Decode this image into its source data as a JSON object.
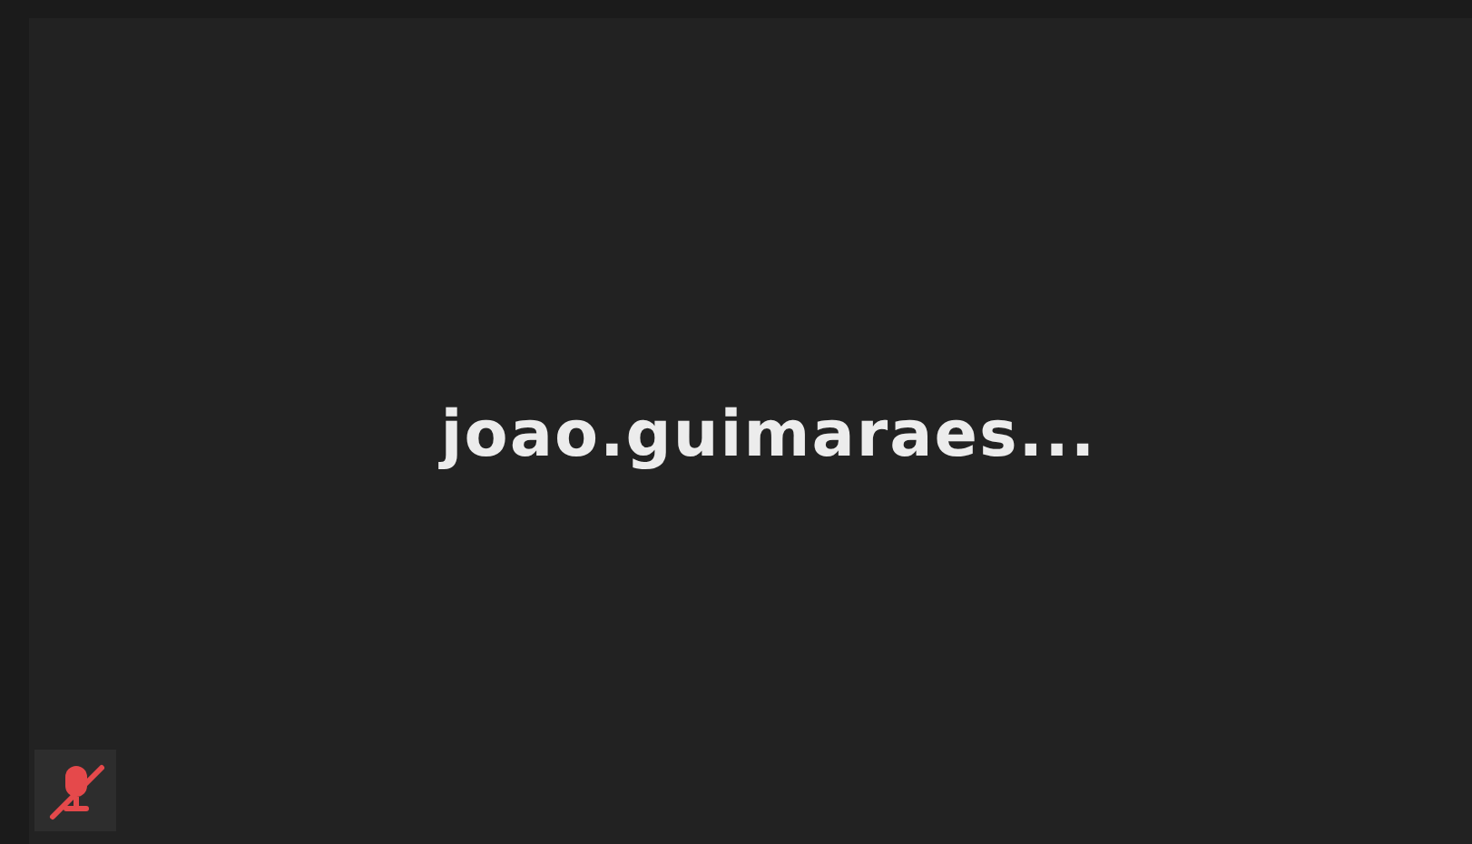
{
  "participant": {
    "name": "joao.guimaraes...",
    "muted": true
  }
}
